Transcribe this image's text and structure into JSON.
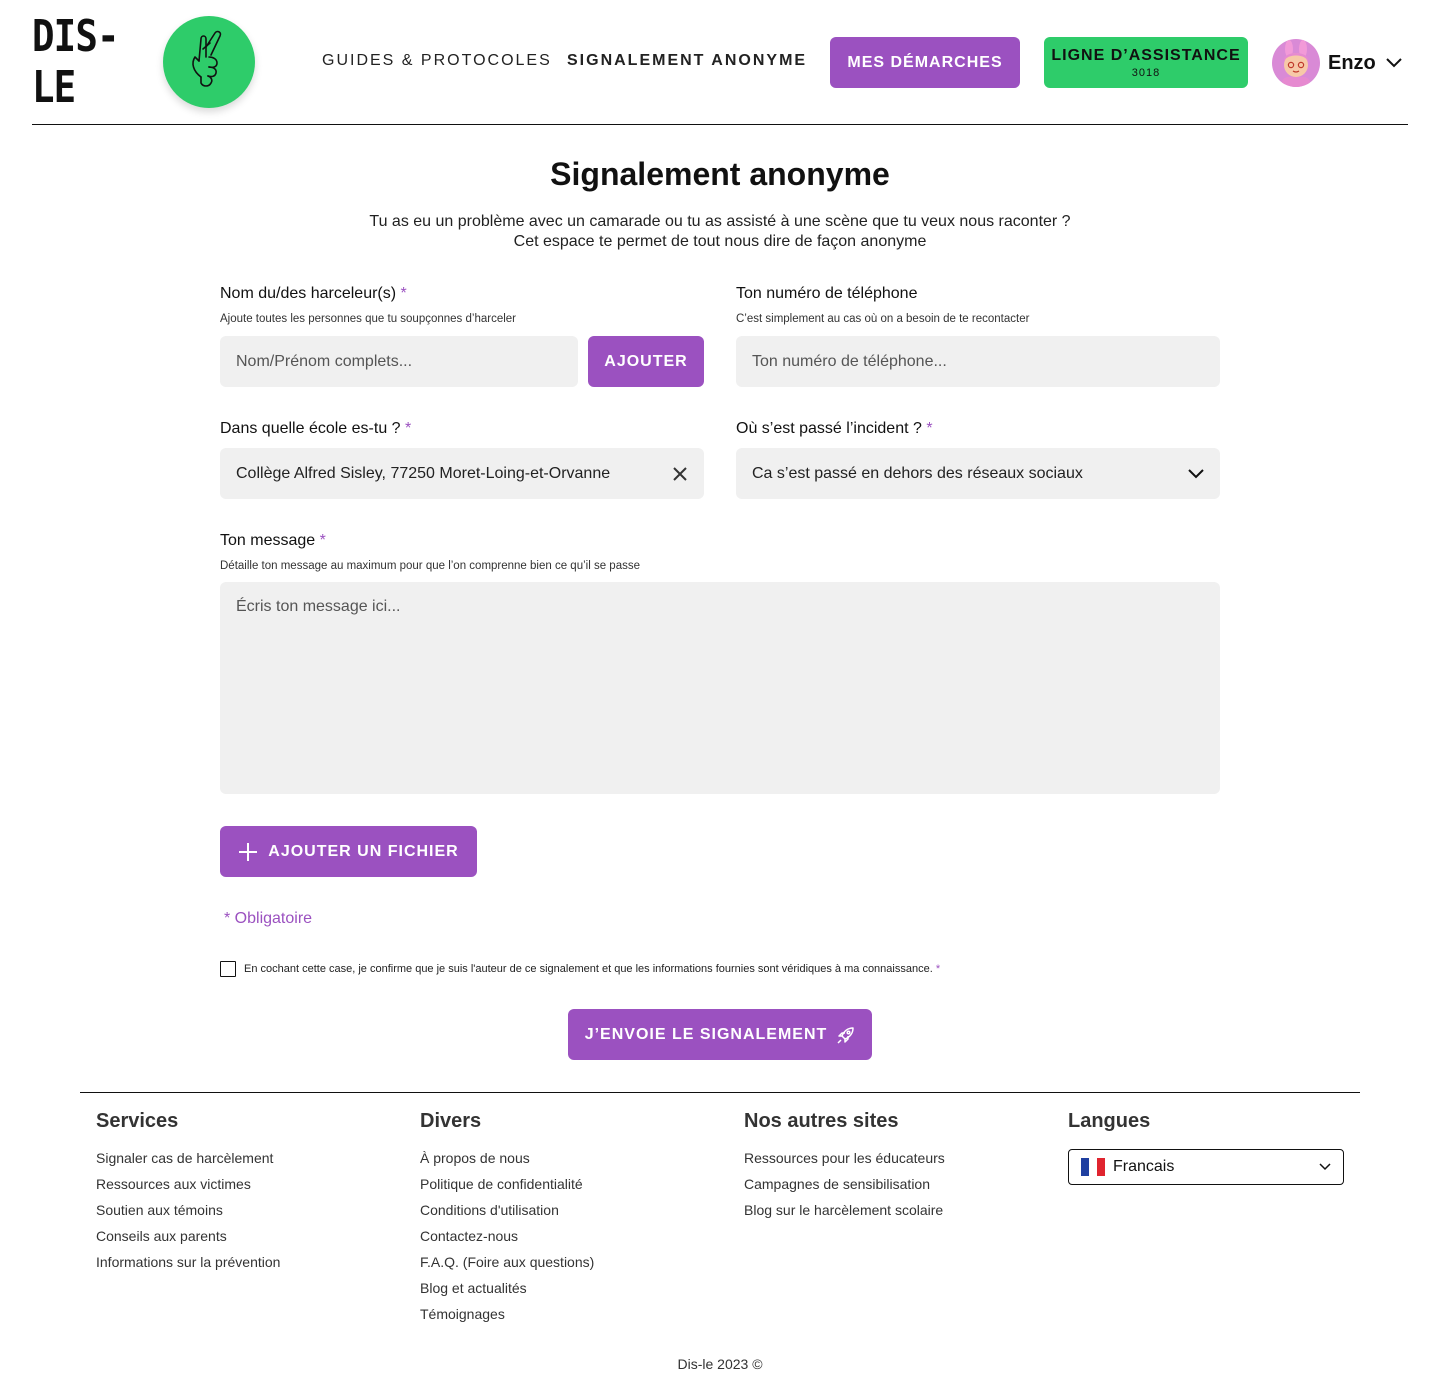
{
  "header": {
    "logo_text": "DIS-LE",
    "nav": {
      "guides": "GUIDES & PROTOCOLES",
      "signalement": "SIGNALEMENT ANONYME",
      "demarches": "MES DÉMARCHES"
    },
    "assistance": {
      "label": "LIGNE D’ASSISTANCE",
      "number": "3018"
    },
    "user": {
      "name": "Enzo"
    }
  },
  "main": {
    "title": "Signalement anonyme",
    "subtitle_line1": "Tu as eu un problème avec un camarade ou tu as assisté à une scène que tu veux nous raconter ?",
    "subtitle_line2": "Cet espace te permet de tout nous dire de façon anonyme",
    "harceleurs": {
      "label": "Nom du/des harceleur(s)",
      "required": "*",
      "hint": "Ajoute toutes les personnes que tu soupçonnes d’harceler",
      "placeholder": "Nom/Prénom complets...",
      "add_button": "AJOUTER"
    },
    "telephone": {
      "label": "Ton numéro de téléphone",
      "hint": "C’est simplement au cas où on a besoin de te recontacter",
      "placeholder": "Ton numéro de téléphone..."
    },
    "ecole": {
      "label": "Dans quelle école es-tu ?",
      "required": "*",
      "value": "Collège Alfred Sisley, 77250 Moret-Loing-et-Orvanne"
    },
    "incident": {
      "label": "Où s’est passé l’incident ?",
      "required": "*",
      "value": "Ca s’est passé en dehors des réseaux sociaux"
    },
    "message": {
      "label": "Ton message",
      "required": "*",
      "hint": "Détaille ton message au maximum pour que l’on comprenne bien ce qu’il se passe",
      "placeholder": "Écris ton message ici..."
    },
    "add_file_button": "AJOUTER UN FICHIER",
    "obligatoire": "* Obligatoire",
    "confirm": {
      "label": "En cochant cette case, je confirme que je suis l'auteur de ce signalement et que les informations fournies sont véridiques à ma connaissance.",
      "required": "*",
      "checked": false
    },
    "submit_button": "J’ENVOIE LE SIGNALEMENT"
  },
  "footer": {
    "services": {
      "title": "Services",
      "items": [
        "Signaler cas de harcèlement",
        "Ressources aux victimes",
        "Soutien aux témoins",
        "Conseils aux parents",
        "Informations sur la prévention"
      ]
    },
    "divers": {
      "title": "Divers",
      "items": [
        "À propos de nous",
        "Politique de confidentialité",
        "Conditions d'utilisation",
        "Contactez-nous",
        "F.A.Q. (Foire aux questions)",
        "Blog et actualités",
        "Témoignages"
      ]
    },
    "autres_sites": {
      "title": "Nos autres sites",
      "items": [
        "Ressources pour les éducateurs",
        "Campagnes de sensibilisation",
        "Blog sur le harcèlement scolaire"
      ]
    },
    "langues": {
      "title": "Langues",
      "selected": "Francais"
    },
    "copyright": "Dis-le 2023 ©"
  },
  "colors": {
    "accent_purple": "#9b51c0",
    "accent_green": "#2ecc6a",
    "field_bg": "#f0f0f0"
  }
}
